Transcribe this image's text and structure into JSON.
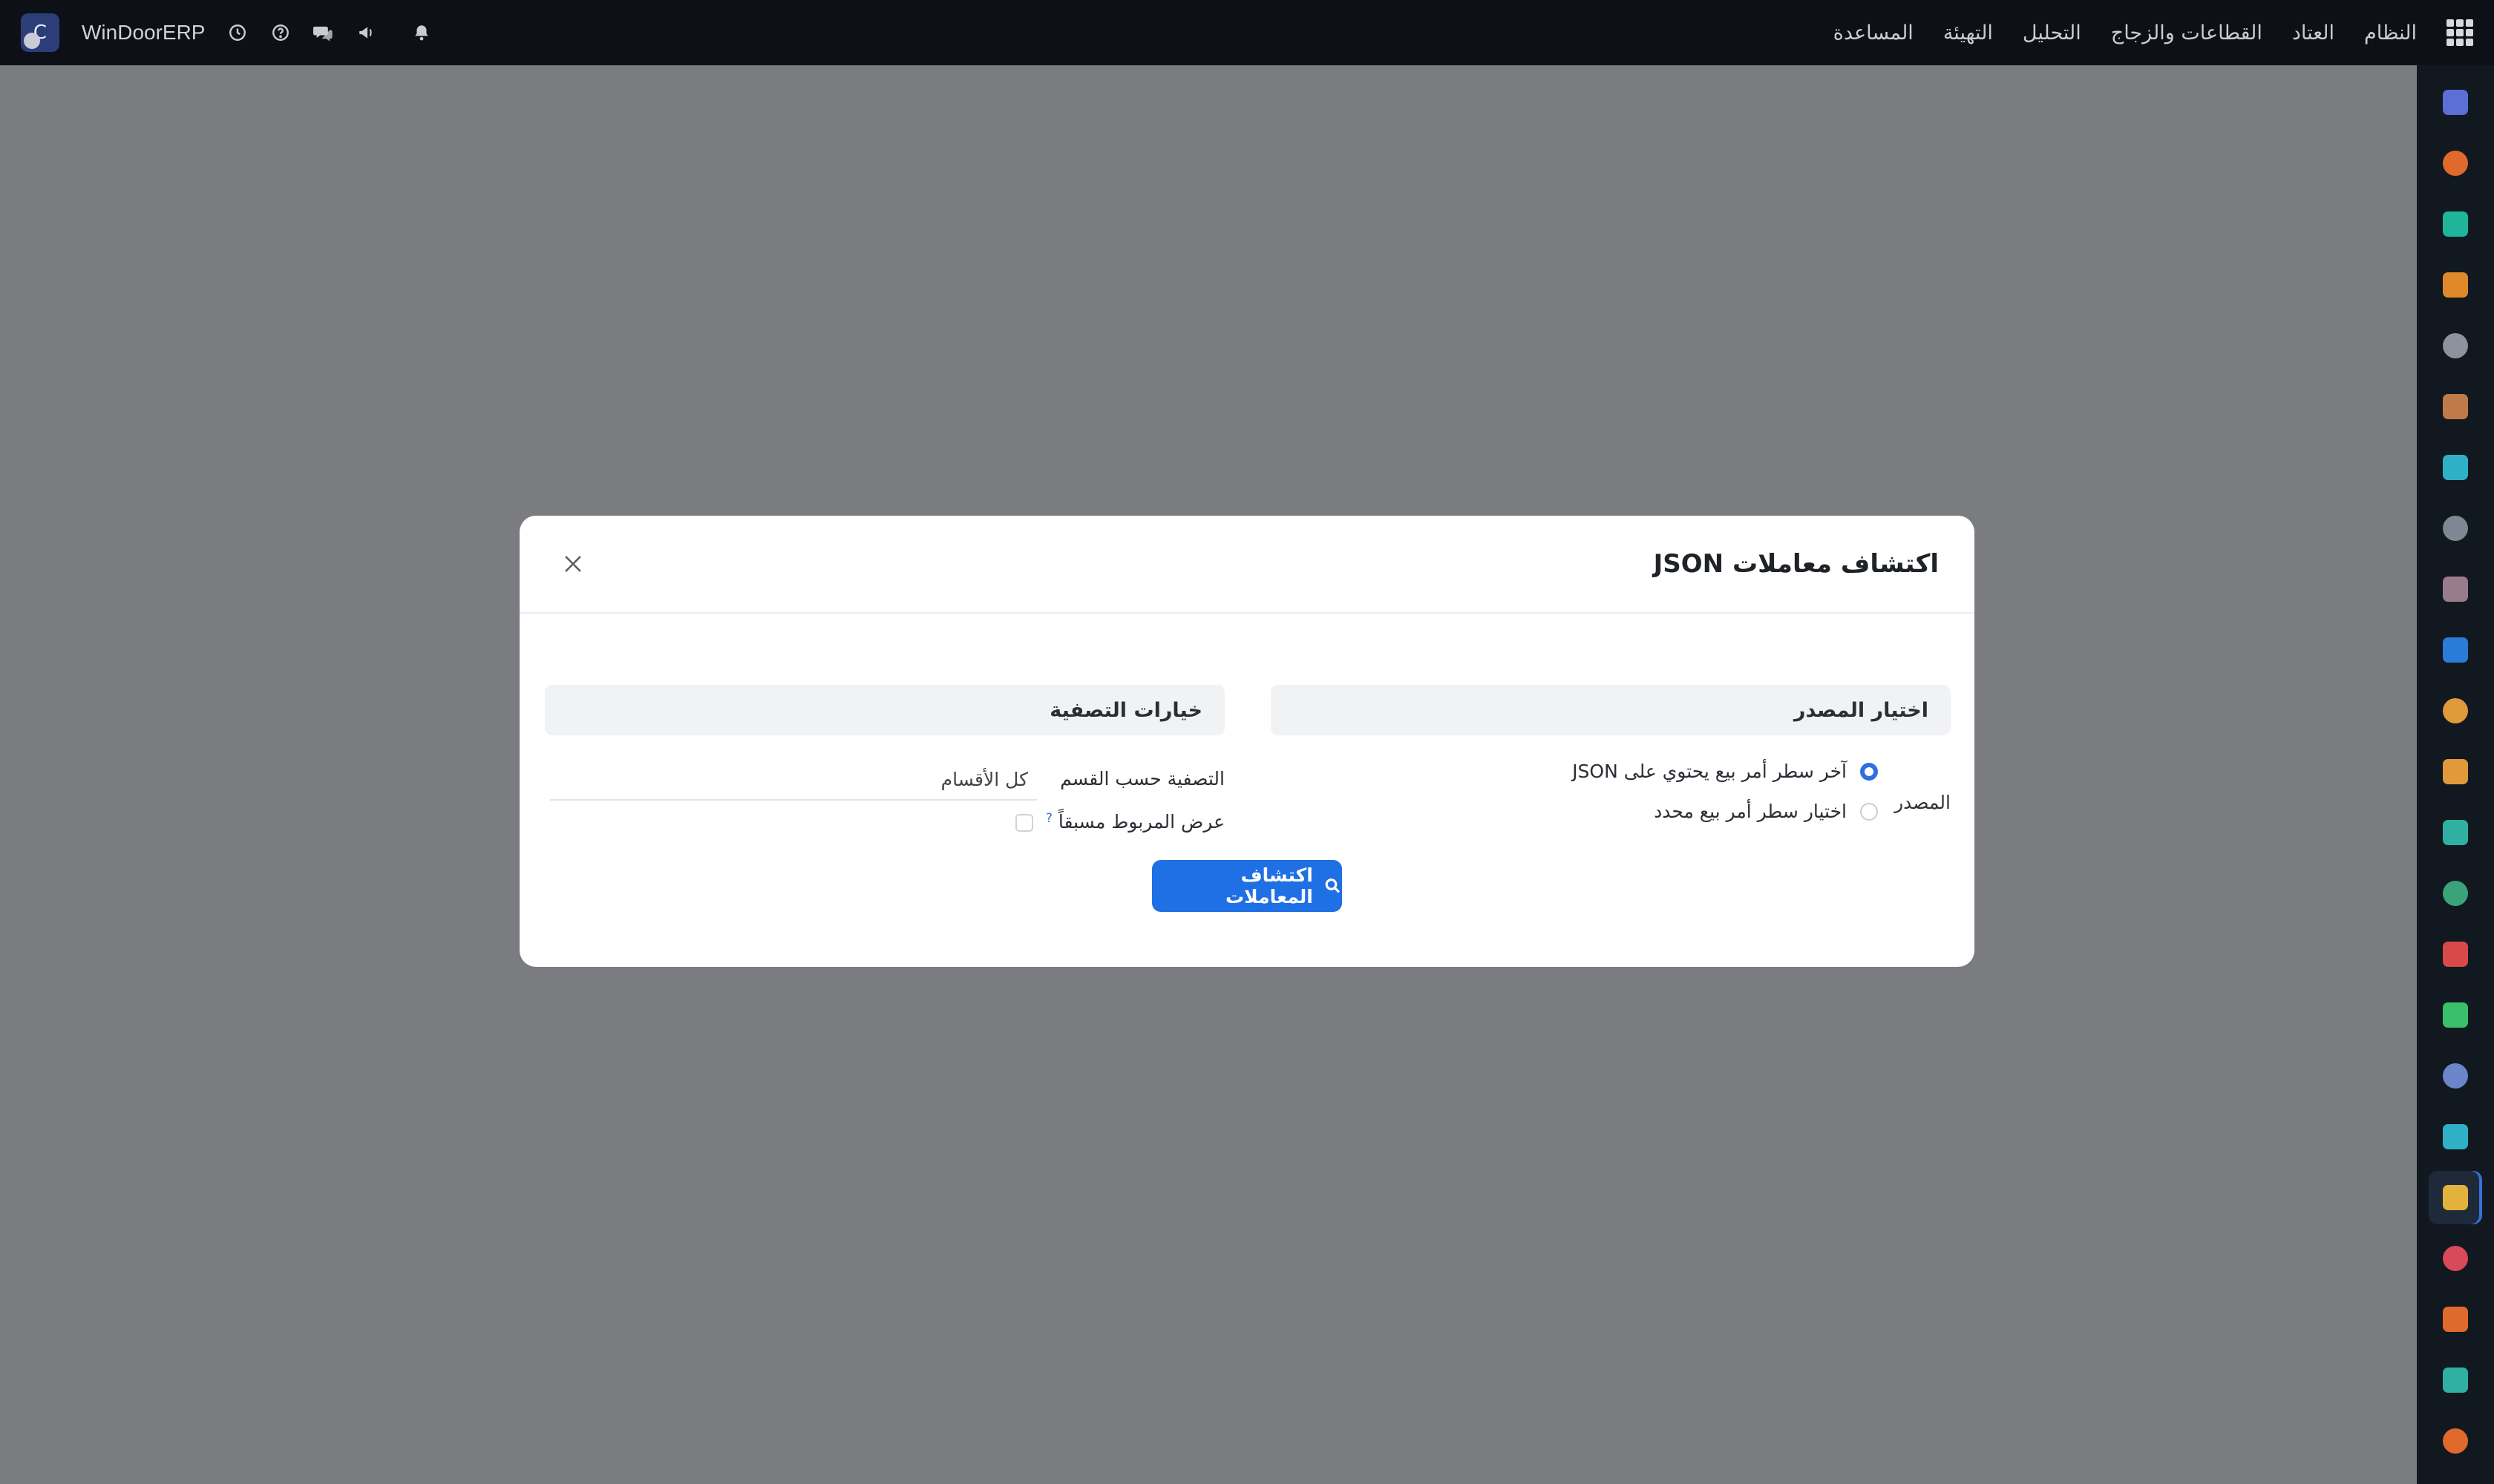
{
  "topbar": {
    "avatar_letter": "C",
    "brand": "WinDoorERP",
    "menu": [
      "النظام",
      "العتاد",
      "القطاعات والزجاج",
      "التحليل",
      "التهيئة",
      "المساعدة"
    ]
  },
  "modal": {
    "title": "اكتشاف معاملات JSON",
    "source_section": {
      "heading": "اختيار المصدر",
      "label": "المصدر",
      "options": [
        {
          "label": "آخر سطر أمر بيع يحتوي على JSON",
          "selected": true
        },
        {
          "label": "اختيار سطر أمر بيع محدد",
          "selected": false
        }
      ]
    },
    "filter_section": {
      "heading": "خيارات التصفية",
      "filter_label": "التصفية حسب القسم",
      "filter_value": "كل الأقسام",
      "linked_label": "عرض المربوط مسبقاً",
      "help_mark": "?",
      "linked_checked": false
    },
    "discover_button": "اكتشاف المعاملات"
  },
  "colors": {
    "primary": "#1f6fe5",
    "navbar": "#0d1117",
    "overlay": "#7b7c7f",
    "dock": "#121820"
  },
  "dock_icons": [
    {
      "name": "gmail-icon",
      "color": "#5b6fd6"
    },
    {
      "name": "chat-bubble-icon",
      "color": "#e06a2b"
    },
    {
      "name": "check-drop-icon",
      "color": "#1fb59a"
    },
    {
      "name": "bar-chart-icon",
      "color": "#e0892b"
    },
    {
      "name": "cube-icon",
      "color": "#8d939c"
    },
    {
      "name": "contact-card-icon",
      "color": "#c07a4a"
    },
    {
      "name": "checkmark-icon",
      "color": "#2fb0c7"
    },
    {
      "name": "inbox-icon",
      "color": "#7e8793"
    },
    {
      "name": "box-icon",
      "color": "#9a7b8c"
    },
    {
      "name": "document-blue-icon",
      "color": "#2b7bd8"
    },
    {
      "name": "users-group-icon",
      "color": "#e09a3a"
    },
    {
      "name": "calendar-31-icon",
      "color": "#e09a3a"
    },
    {
      "name": "pen-icon",
      "color": "#2fb0a0"
    },
    {
      "name": "id-badge-icon",
      "color": "#3aa37a"
    },
    {
      "name": "dashboard-grid-icon",
      "color": "#d84a4a"
    },
    {
      "name": "whatsapp-icon",
      "color": "#3ac06a"
    },
    {
      "name": "compass-icon",
      "color": "#6a86c8"
    },
    {
      "name": "waves-icon",
      "color": "#2fb0c7"
    },
    {
      "name": "paper-plane-icon",
      "color": "#e3b23c"
    },
    {
      "name": "bars-icon",
      "color": "#d84a5a"
    },
    {
      "name": "hexagon-icon",
      "color": "#e06a2b"
    },
    {
      "name": "pie-icon",
      "color": "#2fb0a0"
    },
    {
      "name": "gear-hex-icon",
      "color": "#e06a2b"
    }
  ]
}
